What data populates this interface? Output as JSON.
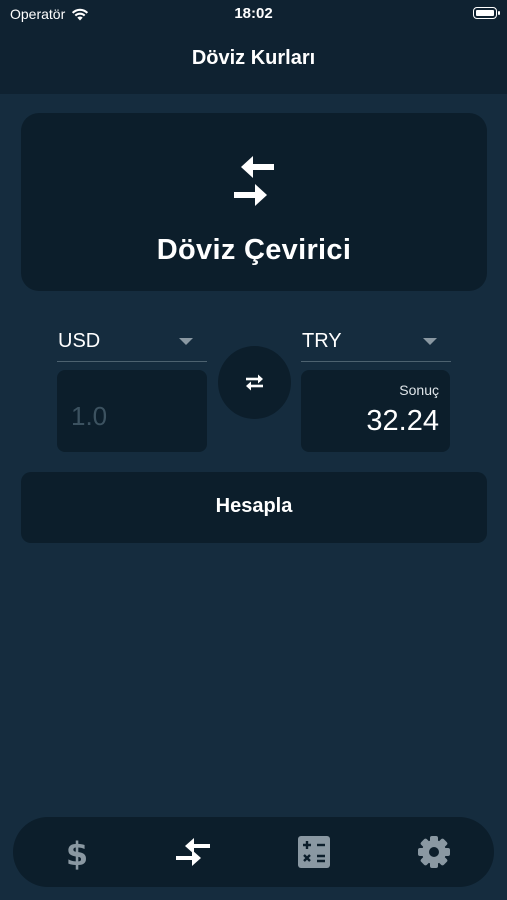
{
  "status_bar": {
    "carrier": "Operatör",
    "time": "18:02"
  },
  "header": {
    "title": "Döviz Kurları"
  },
  "hero": {
    "title": "Döviz Çevirici",
    "icon": "compare-arrows-icon"
  },
  "converter": {
    "from_currency": "USD",
    "to_currency": "TRY",
    "amount_placeholder": "1.0",
    "result_label": "Sonuç",
    "result_value": "32.24"
  },
  "actions": {
    "calculate_label": "Hesapla"
  },
  "tab_bar": {
    "items": [
      {
        "icon": "dollar-icon",
        "active": false
      },
      {
        "icon": "compare-arrows-icon",
        "active": true
      },
      {
        "icon": "calculator-icon",
        "active": false
      },
      {
        "icon": "gear-icon",
        "active": false
      }
    ]
  },
  "colors": {
    "background": "#152c3e",
    "header": "#0f2231",
    "card": "#0c1e2b",
    "text": "#ffffff",
    "muted": "#3c5260",
    "inactive_icon": "#8a98a2"
  }
}
